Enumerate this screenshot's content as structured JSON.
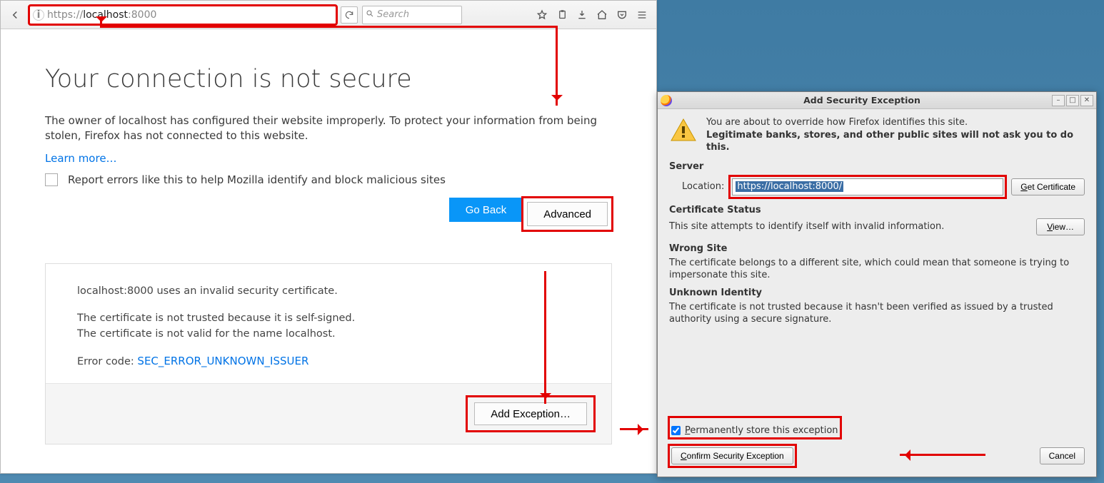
{
  "browser": {
    "url_prefix": "https://",
    "url_host": "localhost",
    "url_suffix": ":8000",
    "search_placeholder": "Search"
  },
  "page": {
    "title": "Your connection is not secure",
    "paragraph": "The owner of localhost has configured their website improperly. To protect your information from being stolen, Firefox has not connected to this website.",
    "learn_more": "Learn more…",
    "report_label": "Report errors like this to help Mozilla identify and block malicious sites",
    "go_back": "Go Back",
    "advanced": "Advanced",
    "details_line1": "localhost:8000 uses an invalid security certificate.",
    "details_line2": "The certificate is not trusted because it is self-signed.",
    "details_line3": "The certificate is not valid for the name localhost.",
    "error_code_label": "Error code: ",
    "error_code": "SEC_ERROR_UNKNOWN_ISSUER",
    "add_exception": "Add Exception…"
  },
  "dialog": {
    "title": "Add Security Exception",
    "warn1": "You are about to override how Firefox identifies this site.",
    "warn2": "Legitimate banks, stores, and other public sites will not ask you to do this.",
    "server_h": "Server",
    "location_label": "Location:",
    "location_value": "https://localhost:8000/",
    "get_cert": "Get Certificate",
    "cert_status_h": "Certificate Status",
    "cert_status_line": "This site attempts to identify itself with invalid information.",
    "view": "View…",
    "wrong_site_h": "Wrong Site",
    "wrong_site_p": "The certificate belongs to a different site, which could mean that someone is trying to impersonate this site.",
    "unknown_h": "Unknown Identity",
    "unknown_p": "The certificate is not trusted because it hasn't been verified as issued by a trusted authority using a secure signature.",
    "perm_label": "Permanently store this exception",
    "confirm": "Confirm Security Exception",
    "cancel": "Cancel"
  }
}
